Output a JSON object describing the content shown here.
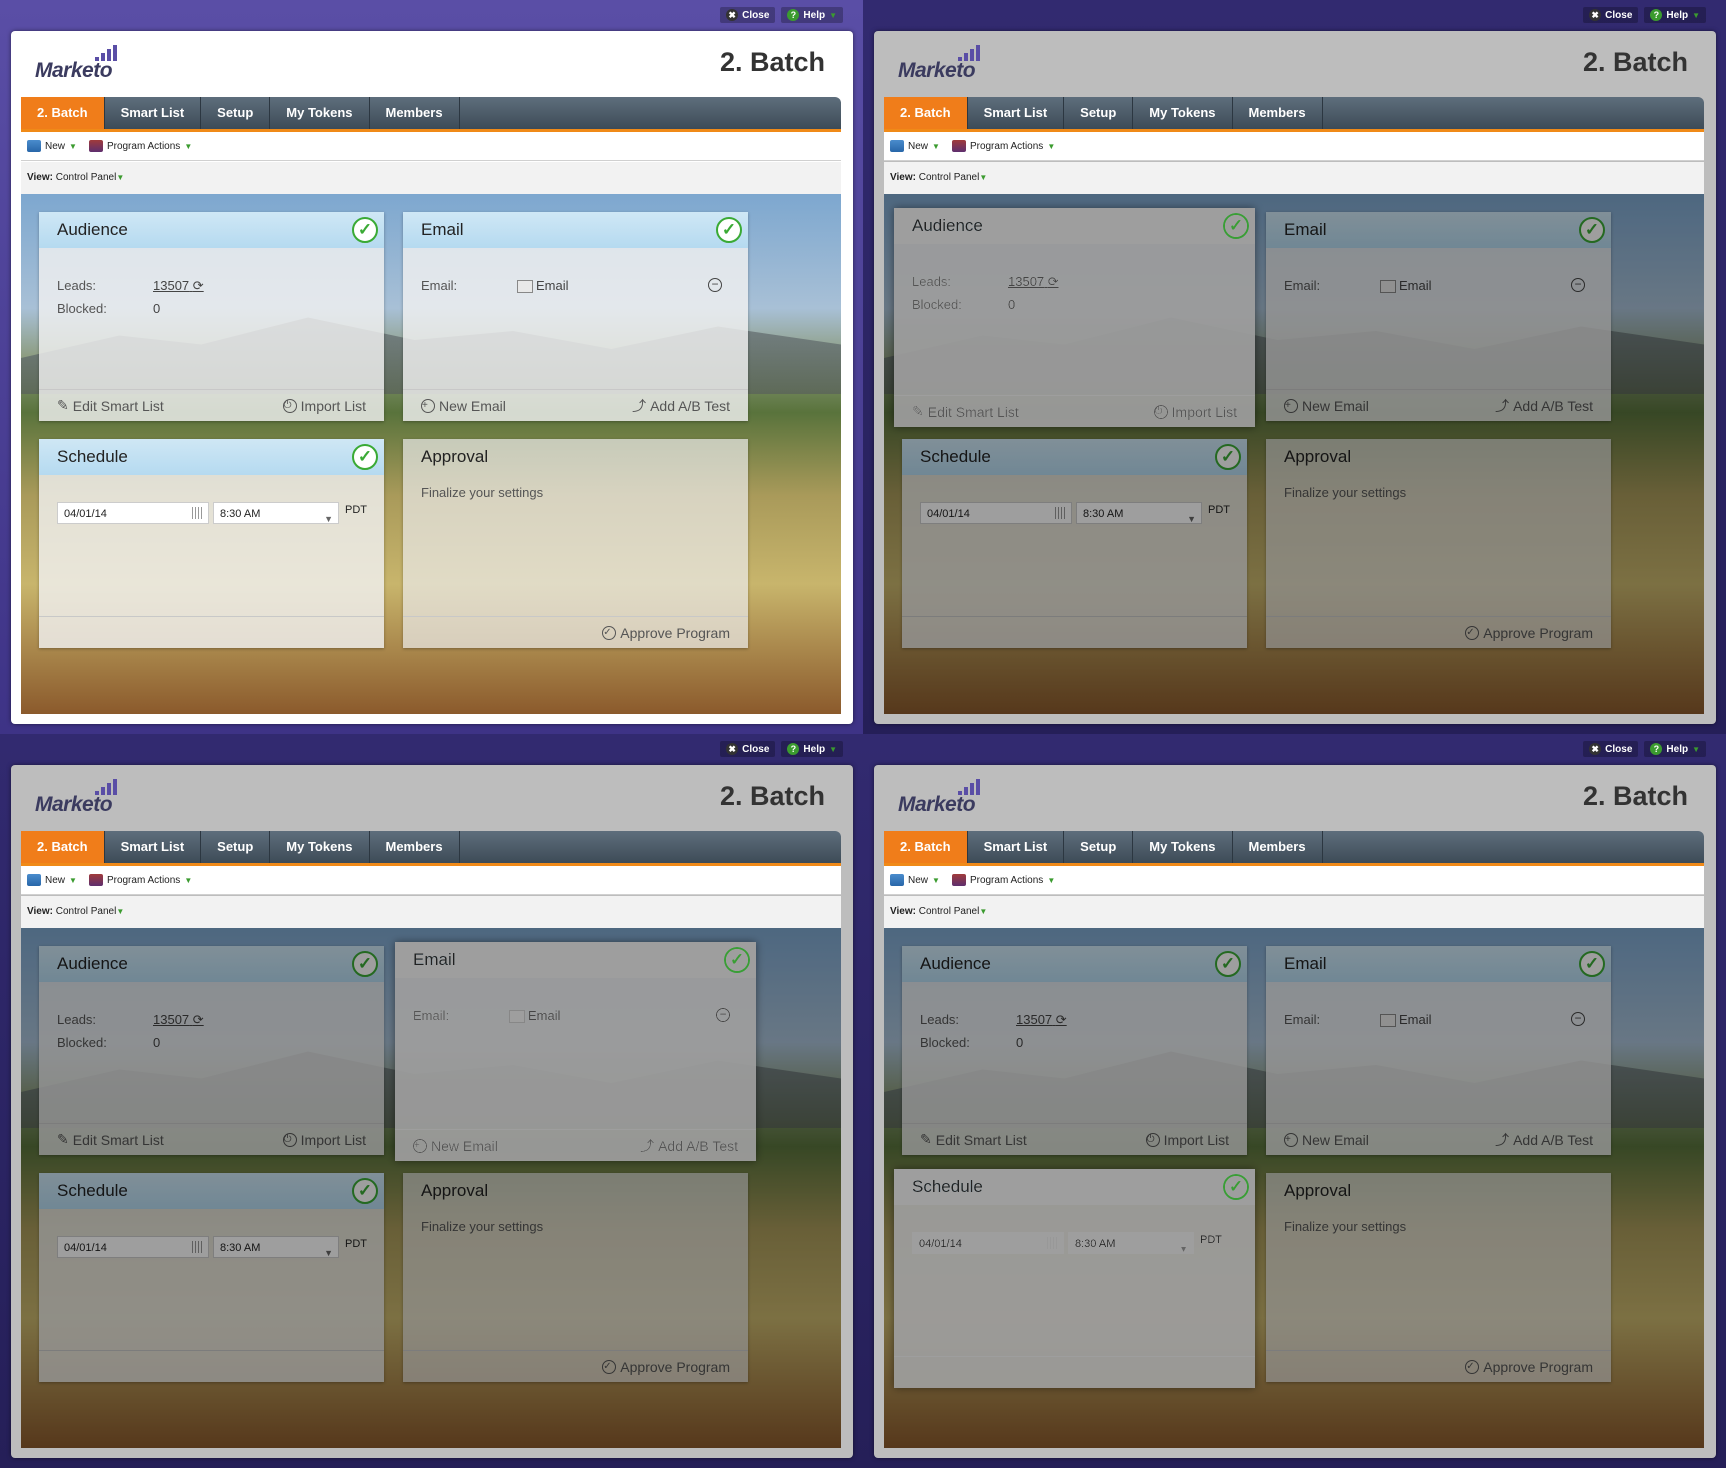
{
  "topbar": {
    "close": "Close",
    "help": "Help"
  },
  "logo": {
    "text": "Marketo"
  },
  "header": {
    "title": "2. Batch"
  },
  "tabs": [
    "2. Batch",
    "Smart List",
    "Setup",
    "My Tokens",
    "Members"
  ],
  "toolbar": {
    "new": "New",
    "program_actions": "Program Actions"
  },
  "view": {
    "label": "View:",
    "value": "Control Panel"
  },
  "audience": {
    "title": "Audience",
    "leads_label": "Leads:",
    "leads_value": "13507",
    "blocked_label": "Blocked:",
    "blocked_value": "0",
    "edit": "Edit Smart List",
    "import": "Import List"
  },
  "email": {
    "title": "Email",
    "email_label": "Email:",
    "email_value": "Email",
    "new": "New Email",
    "ab": "Add A/B Test"
  },
  "schedule": {
    "title": "Schedule",
    "date": "04/01/14",
    "time": "8:30 AM",
    "tz": "PDT"
  },
  "approval": {
    "title": "Approval",
    "text": "Finalize your settings",
    "approve": "Approve Program"
  },
  "colors": {
    "accent": "#f07d1a",
    "purple": "#5a4ea6",
    "check": "#3aaa35"
  }
}
